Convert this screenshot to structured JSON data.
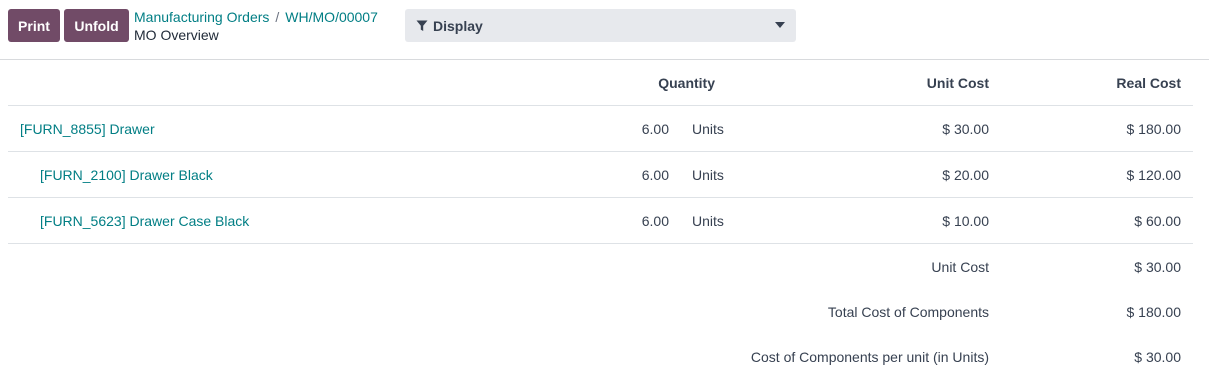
{
  "toolbar": {
    "print_label": "Print",
    "unfold_label": "Unfold"
  },
  "breadcrumb": {
    "parent": "Manufacturing Orders",
    "separator": "/",
    "record": "WH/MO/00007",
    "current": "MO Overview"
  },
  "display": {
    "label": "Display",
    "icon": "filter-icon"
  },
  "table": {
    "headers": {
      "quantity": "Quantity",
      "unit_cost": "Unit Cost",
      "real_cost": "Real Cost"
    },
    "rows": [
      {
        "name": "[FURN_8855] Drawer",
        "qty": "6.00",
        "uom": "Units",
        "unit_cost": "$ 30.00",
        "real_cost": "$ 180.00"
      },
      {
        "name": "[FURN_2100] Drawer Black",
        "qty": "6.00",
        "uom": "Units",
        "unit_cost": "$ 20.00",
        "real_cost": "$ 120.00"
      },
      {
        "name": "[FURN_5623] Drawer Case Black",
        "qty": "6.00",
        "uom": "Units",
        "unit_cost": "$ 10.00",
        "real_cost": "$ 60.00"
      }
    ],
    "summary": [
      {
        "label": "Unit Cost",
        "value": "$ 30.00"
      },
      {
        "label": "Total Cost of Components",
        "value": "$ 180.00"
      },
      {
        "label": "Cost of Components per unit (in Units)",
        "value": "$ 30.00"
      }
    ]
  },
  "colors": {
    "brand": "#714b67",
    "link": "#017e84"
  }
}
